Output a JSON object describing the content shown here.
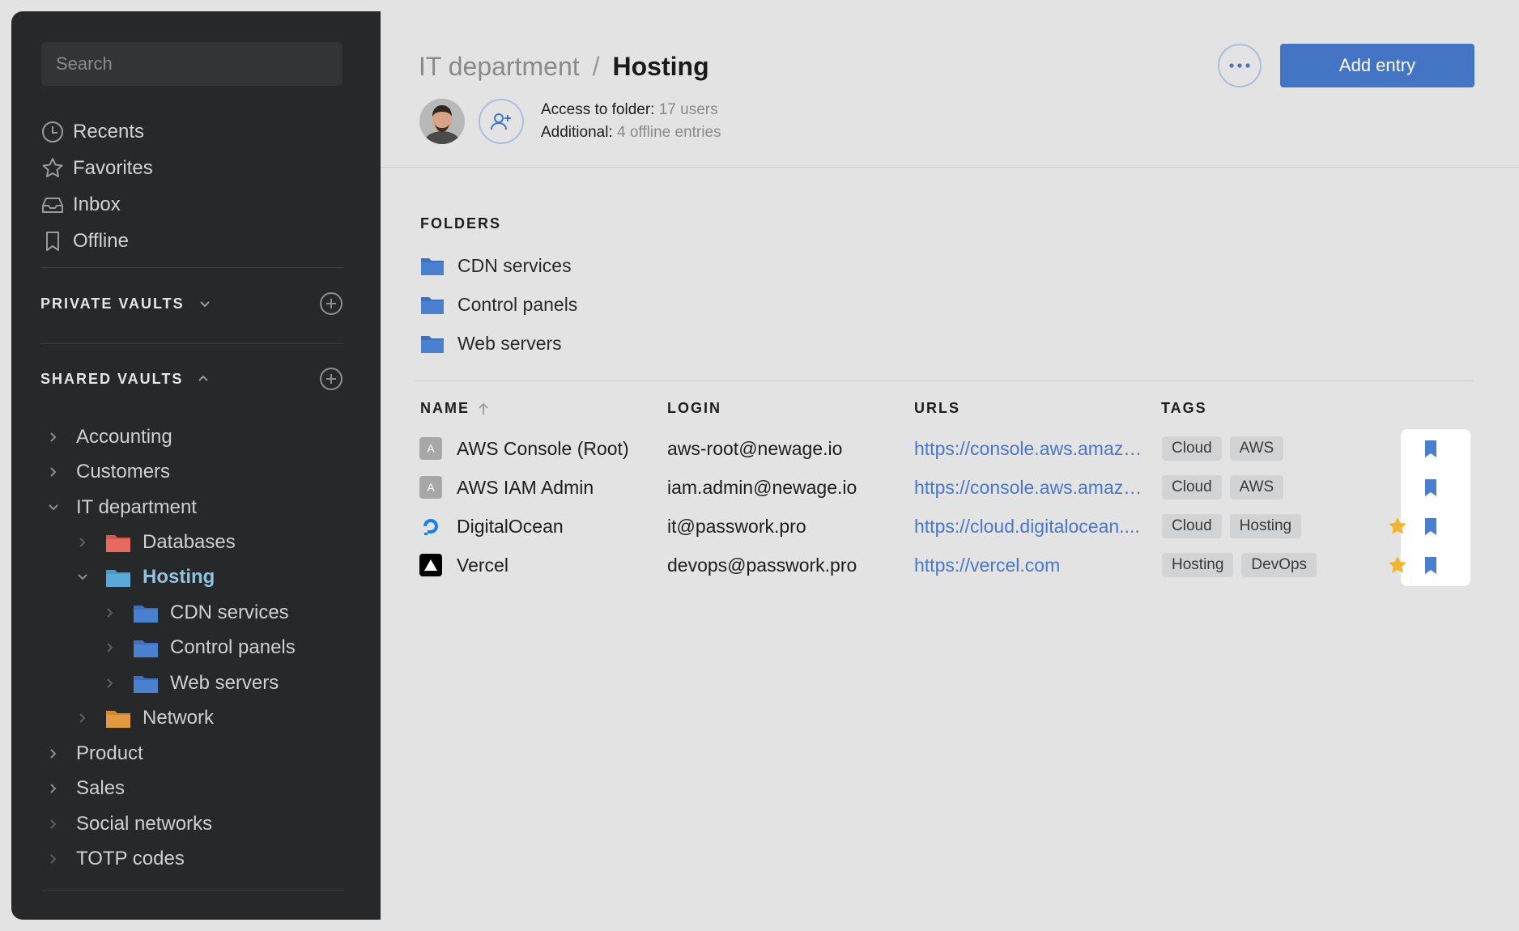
{
  "sidebar": {
    "search_placeholder": "Search",
    "nav": [
      {
        "label": "Recents",
        "icon": "clock-icon"
      },
      {
        "label": "Favorites",
        "icon": "star-icon"
      },
      {
        "label": "Inbox",
        "icon": "inbox-icon"
      },
      {
        "label": "Offline",
        "icon": "bookmark-icon"
      }
    ],
    "private_vaults_label": "PRIVATE VAULTS",
    "shared_vaults_label": "SHARED VAULTS",
    "tree": [
      {
        "label": "Accounting"
      },
      {
        "label": "Customers"
      },
      {
        "label": "IT department"
      },
      {
        "label": "Databases",
        "folder_color": "#d9574f"
      },
      {
        "label": "Hosting",
        "folder_color": "#5aaad8"
      },
      {
        "label": "CDN services",
        "folder_color": "#4a80d0"
      },
      {
        "label": "Control panels",
        "folder_color": "#4a80d0"
      },
      {
        "label": "Web servers",
        "folder_color": "#4a80d0"
      },
      {
        "label": "Network",
        "folder_color": "#e39a3c"
      },
      {
        "label": "Product"
      },
      {
        "label": "Sales"
      },
      {
        "label": "Social networks"
      },
      {
        "label": "TOTP codes"
      }
    ]
  },
  "header": {
    "breadcrumb_parent": "IT department",
    "breadcrumb_sep": "/",
    "breadcrumb_current": "Hosting",
    "add_entry_label": "Add entry",
    "access_label": "Access to folder:",
    "access_value": "17 users",
    "additional_label": "Additional:",
    "additional_value": "4 offline entries"
  },
  "folders": {
    "title": "FOLDERS",
    "items": [
      "CDN services",
      "Control panels",
      "Web servers"
    ],
    "color": "#4a80d0"
  },
  "table": {
    "columns": {
      "name": "NAME",
      "login": "LOGIN",
      "urls": "URLS",
      "tags": "TAGS"
    },
    "rows": [
      {
        "name": "AWS Console (Root)",
        "icon_letter": "A",
        "login": "aws-root@newage.io",
        "url": "https://console.aws.amazo...",
        "tags": [
          "Cloud",
          "AWS"
        ],
        "favorite": false
      },
      {
        "name": "AWS IAM Admin",
        "icon_letter": "A",
        "login": "iam.admin@newage.io",
        "url": "https://console.aws.amazo...",
        "tags": [
          "Cloud",
          "AWS"
        ],
        "favorite": false
      },
      {
        "name": "DigitalOcean",
        "icon_letter": "",
        "login": "it@passwork.pro",
        "url": "https://cloud.digitalocean....",
        "tags": [
          "Cloud",
          "Hosting"
        ],
        "favorite": true
      },
      {
        "name": "Vercel",
        "icon_letter": "",
        "login": "devops@passwork.pro",
        "url": "https://vercel.com",
        "tags": [
          "Hosting",
          "DevOps"
        ],
        "favorite": true
      }
    ]
  },
  "colors": {
    "accent": "#4474c4",
    "link": "#4a78c8",
    "star": "#f3b52f",
    "sidebar_bg": "#272829"
  }
}
